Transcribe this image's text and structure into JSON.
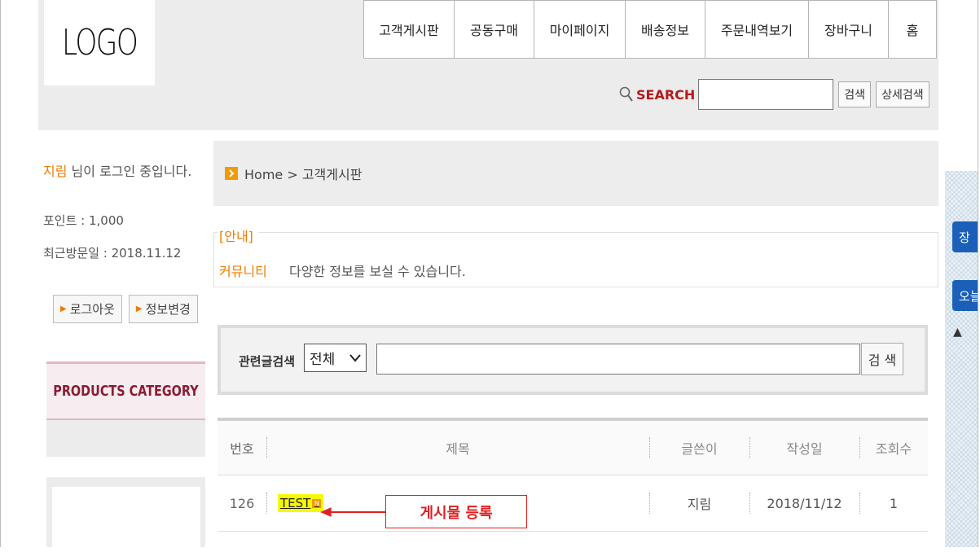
{
  "logo": "LOGO",
  "nav": [
    "고객게시판",
    "공동구매",
    "마이페이지",
    "배송정보",
    "주문내역보기",
    "장바구니",
    "홈"
  ],
  "search": {
    "label": "SEARCH",
    "button": "검색",
    "detail_button": "상세검색"
  },
  "sidebar": {
    "username": "지림",
    "login_suffix": " 님이 로그인 중입니다.",
    "points": "포인트 : 1,000",
    "last_visit": "최근방문일 : 2018.11.12",
    "logout": "로그아웃",
    "edit_info": "정보변경",
    "category_title": "PRODUCTS CATEGORY"
  },
  "breadcrumb": "Home > 고객게시판",
  "notice": {
    "title": "[안내]",
    "community": "커뮤니티",
    "desc": "다양한 정보를 보실 수 있습니다."
  },
  "filter": {
    "label": "관련글검색",
    "select_value": "전체",
    "button": "검 색"
  },
  "board": {
    "headers": {
      "num": "번호",
      "title": "제목",
      "writer": "글쓴이",
      "date": "작성일",
      "views": "조회수"
    },
    "rows": [
      {
        "num": "126",
        "title": "TEST",
        "badge": "N",
        "writer": "지림",
        "date": "2018/11/12",
        "views": "1"
      }
    ]
  },
  "annotation": "게시물 등록",
  "right_widget": {
    "btn1": "장",
    "btn2": "오늘",
    "up": "▲"
  },
  "colors": {
    "accent": "#f07b00",
    "annotation": "#e02020",
    "widget_blue": "#1b5fb9"
  }
}
